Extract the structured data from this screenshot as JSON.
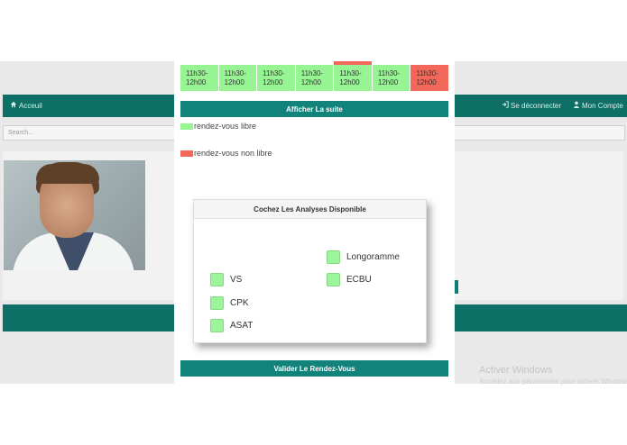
{
  "background": {
    "nav_home": "Acceuil",
    "nav_logout": "Se déconnecter",
    "nav_account": "Mon Compte",
    "search_placeholder": "Search..."
  },
  "modal": {
    "slots": [
      {
        "line1": "11h30-",
        "line2": "12h00",
        "status": "free",
        "topbar": null
      },
      {
        "line1": "11h30-",
        "line2": "12h00",
        "status": "free",
        "topbar": null
      },
      {
        "line1": "11h30-",
        "line2": "12h00",
        "status": "free",
        "topbar": null
      },
      {
        "line1": "11h30-",
        "line2": "12h00",
        "status": "free",
        "topbar": null
      },
      {
        "line1": "11h30-",
        "line2": "12h00",
        "status": "free",
        "topbar": "busy"
      },
      {
        "line1": "11h30-",
        "line2": "12h00",
        "status": "free",
        "topbar": null
      },
      {
        "line1": "11h30-",
        "line2": "12h00",
        "status": "busy",
        "topbar": null
      }
    ],
    "show_more_label": "Afficher La suite",
    "legend_free": "rendez-vous libre",
    "legend_busy": "rendez-vous non libre",
    "panel_title": "Cochez Les Analyses Disponible",
    "analyses": {
      "longoramme": "Longoramme",
      "vs": "VS",
      "ecbu": "ECBU",
      "cpk": "CPK",
      "asat": "ASAT"
    },
    "validate_label": "Valider Le Rendez-Vous"
  },
  "watermark": {
    "title": "Activer Windows",
    "subtitle": "Accédez aux paramètres pour activer Windows."
  },
  "colors": {
    "teal": "#11837b",
    "free": "#96f592",
    "busy": "#f1685a"
  }
}
